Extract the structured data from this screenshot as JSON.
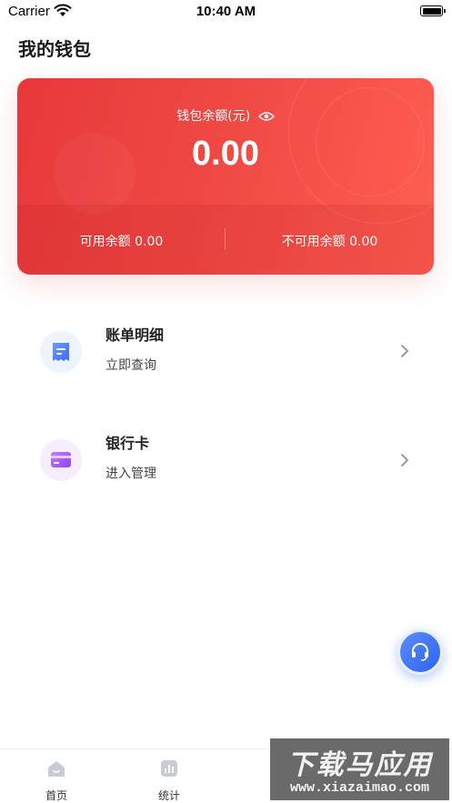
{
  "status_bar": {
    "carrier": "Carrier",
    "time": "10:40 AM"
  },
  "page": {
    "title": "我的钱包"
  },
  "wallet_card": {
    "balance_label": "钱包余额(元)",
    "balance": "0.00",
    "available": "可用余额 0.00",
    "unavailable": "不可用余额 0.00",
    "accent_start": "#e8383a",
    "accent_end": "#ff5e52"
  },
  "menu": {
    "items": [
      {
        "title": "账单明细",
        "subtitle": "立即查询",
        "icon": "bill-icon",
        "icon_color": "#4a7dff"
      },
      {
        "title": "银行卡",
        "subtitle": "进入管理",
        "icon": "bank-card-icon",
        "icon_color": "#a55cf5"
      }
    ]
  },
  "fab": {
    "icon": "headset-icon"
  },
  "tab_bar": {
    "tabs": [
      {
        "label": "首页",
        "icon": "home-icon"
      },
      {
        "label": "统计",
        "icon": "stats-icon"
      }
    ]
  },
  "watermark": {
    "line1": "下载马应用",
    "line2": "www.xiazaimao.com"
  }
}
